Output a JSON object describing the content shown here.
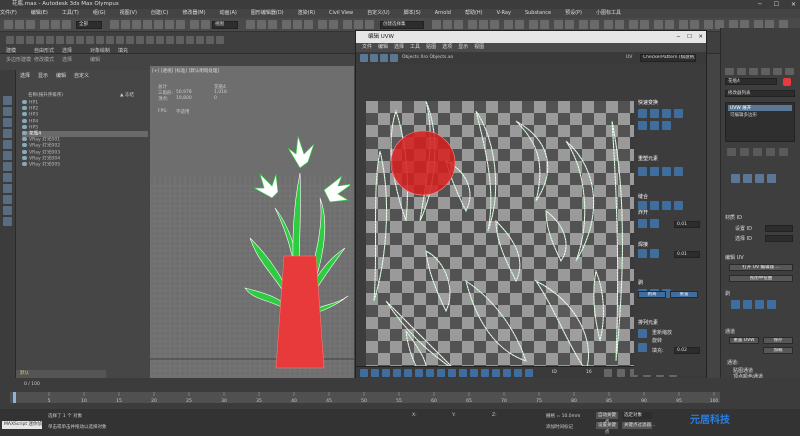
{
  "app": {
    "title": "花瓶.max - Autodesk 3ds Max Olympus"
  },
  "menubar": {
    "items": [
      "文件(F)",
      "编辑(E)",
      "工具(T)",
      "组(G)",
      "视图(V)",
      "创建(C)",
      "修改器(M)",
      "动画(A)",
      "图形编辑器(D)",
      "渲染(R)",
      "Civil View",
      "自定义(U)",
      "脚本(S)",
      "Arnold",
      "帮助(H)",
      "V-Ray",
      "Substance",
      "预设(P)",
      "小图标工具"
    ]
  },
  "ribbon": {
    "tabs": [
      "建模",
      "自由形式",
      "选择",
      "对象绘制",
      "填充"
    ],
    "row2": [
      "多边形建模",
      "修改模式",
      "选择",
      "编辑"
    ]
  },
  "selection_set": "创建选择集",
  "view_label": "视图",
  "explorer": {
    "menus": [
      "选择",
      "显示",
      "编辑",
      "自定义"
    ],
    "column": "名称(按升序排序)",
    "frozen_header": "▲ 冻结",
    "items": [
      {
        "name": "HP1",
        "selected": false
      },
      {
        "name": "HP2",
        "selected": false
      },
      {
        "name": "HP3",
        "selected": false
      },
      {
        "name": "HP4",
        "selected": false
      },
      {
        "name": "HP5",
        "selected": false
      },
      {
        "name": "花瓶4",
        "selected": true
      },
      {
        "name": "VRay 灯光001",
        "selected": false
      },
      {
        "name": "VRay 灯光002",
        "selected": false
      },
      {
        "name": "VRay 灯光003",
        "selected": false
      },
      {
        "name": "VRay 灯光004",
        "selected": false
      },
      {
        "name": "VRay 灯光005",
        "selected": false
      }
    ],
    "layer": "默认"
  },
  "viewport": {
    "label": "[+] [透视] [标准] [默认明暗处理]",
    "stats": {
      "header_total": "总计",
      "header_object": "花瓶4",
      "rows": [
        {
          "label": "三角形:",
          "total": "50,978",
          "object": "1,018"
        },
        {
          "label": "顶点:",
          "total": "19,800",
          "object": "0"
        }
      ],
      "fps_label": "FPS:",
      "fps_value": "不适用"
    }
  },
  "uv_editor": {
    "title": "编辑 UVW",
    "menus": [
      "文件",
      "编辑",
      "选择",
      "工具",
      "贴图",
      "选项",
      "显示",
      "视图"
    ],
    "uv_label": "UV",
    "checker": "CheckerPattern (棋盘格)",
    "path_text": "Objects Xro Objects.xo",
    "bottom_value": "16",
    "bottom_value2": "ID",
    "right_sections": [
      {
        "title": "快速变换"
      },
      {
        "title": "重塑元素"
      },
      {
        "title": "缝合"
      },
      {
        "title": "炸开"
      },
      {
        "title": "焊接"
      },
      {
        "title": "剥",
        "buttons": [
          "剥离",
          "重置"
        ]
      },
      {
        "title": "排列元素",
        "items": [
          "重新缩放",
          "旋转",
          "填充:"
        ]
      }
    ],
    "weld_value": "0.01",
    "stitch_value": "0.01",
    "pad_value": "0.02"
  },
  "command_panel": {
    "object_name": "花瓶4",
    "modifier_list": "修改器列表",
    "stack": [
      "UVW 展开",
      "可编辑多边形"
    ],
    "section_id": "材质 ID",
    "set_id_label": "设置 ID",
    "select_id_label": "选择 ID",
    "section_edit": "编辑 UV",
    "open_editor": "打开 UV 编辑器 ...",
    "tweak": "视图中扭曲",
    "section_peel": "剥",
    "section_channel": "通道",
    "reset_uvw": "重置 UVW",
    "save": "保存",
    "load": "加载",
    "channel_label": "通道:",
    "map_channel": "贴图通道",
    "vertex_color": "顶点颜色通道"
  },
  "timeline": {
    "frame": "0 / 100",
    "ticks": [
      "0",
      "5",
      "10",
      "15",
      "20",
      "25",
      "30",
      "35",
      "40",
      "45",
      "50",
      "55",
      "60",
      "65",
      "70",
      "75",
      "80",
      "85",
      "90",
      "95",
      "100"
    ]
  },
  "status": {
    "maxscript": "MAXScript 迷你侦听器",
    "selected": "选择了 1 个 对象",
    "prompt": "单击或单击并拖动以选择对象",
    "coords": {
      "x_label": "X:",
      "x": "",
      "y_label": "Y:",
      "y": "",
      "z_label": "Z:",
      "z": ""
    },
    "grid": "栅格 = 10.0mm",
    "add_key": "添加时间标记",
    "auto_key": "自动关键点",
    "set_key": "设置关键点",
    "filter": "关键点过滤器...",
    "selected_obj": "选定对象"
  },
  "watermark": "元居科技",
  "colors": {
    "vase": "#e83a3a",
    "uv_wire": "#ffffff",
    "uv_green": "#39d353",
    "checker_dark": "#3a3a3a",
    "checker_light": "#9a9a9a",
    "brush": "#d81d1d",
    "leaf": "#2ecc40"
  }
}
